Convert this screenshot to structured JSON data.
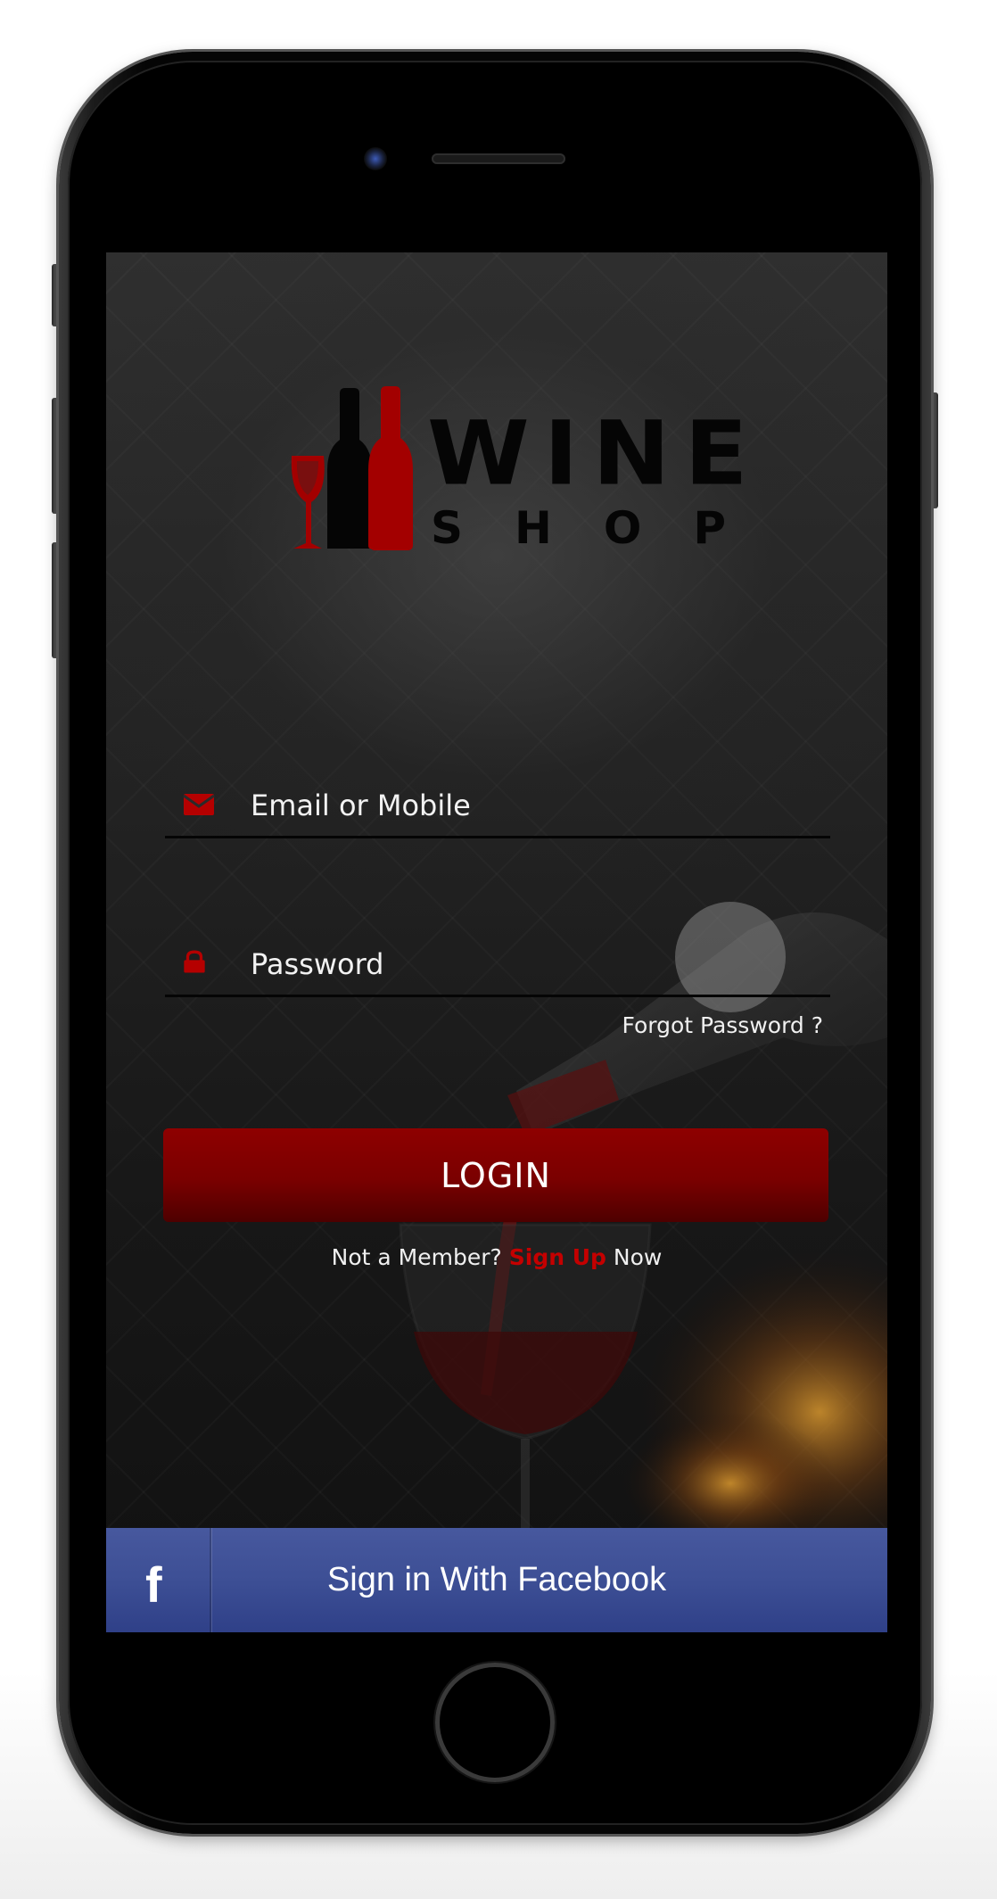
{
  "logo": {
    "word_top": "WINE",
    "word_bottom": "SHOP",
    "icon": "wine-bottles-glass-icon"
  },
  "login_form": {
    "email": {
      "placeholder": "Email or Mobile",
      "value": "",
      "icon": "envelope-icon"
    },
    "password": {
      "placeholder": "Password",
      "value": "",
      "icon": "lock-icon"
    },
    "forgot_label": "Forgot Password ?",
    "login_label": "LOGIN",
    "member_prefix": "Not a Member?",
    "signup_label": "Sign Up",
    "member_suffix": "Now"
  },
  "facebook": {
    "label": "Sign in With Facebook",
    "icon_glyph": "f",
    "icon": "facebook-icon"
  },
  "colors": {
    "accent_red": "#8e0000",
    "signup_red": "#c40000",
    "facebook_blue": "#3d4f95"
  }
}
